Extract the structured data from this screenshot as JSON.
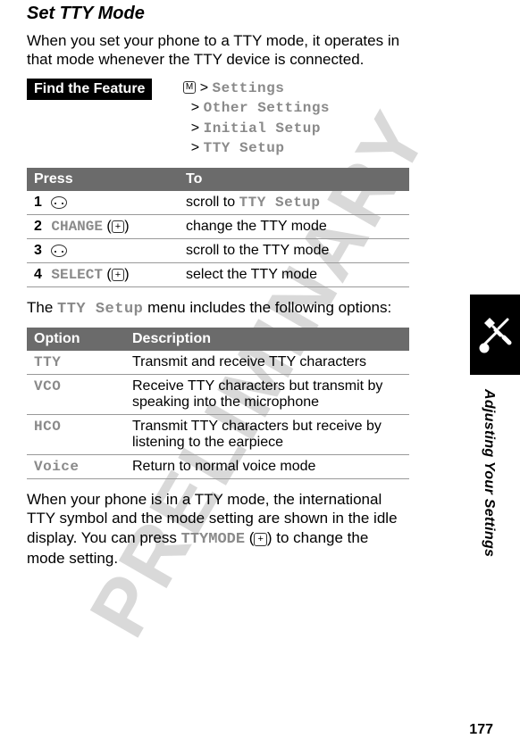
{
  "watermark": "PRELIMINARY",
  "heading": "Set TTY Mode",
  "intro": "When you set your phone to a TTY mode, it operates in that mode whenever the TTY device is connected.",
  "feature_label": "Find the Feature",
  "menu_key": "M",
  "path": {
    "gt": ">",
    "lvl1": "Settings",
    "lvl2": "Other Settings",
    "lvl3": "Initial Setup",
    "lvl4": "TTY Setup"
  },
  "steps_header": {
    "press": "Press",
    "to": "To"
  },
  "steps": [
    {
      "n": "1",
      "press_type": "nav",
      "to_pre": "scroll to ",
      "to_mono": "TTY Setup",
      "to_post": ""
    },
    {
      "n": "2",
      "press_type": "soft",
      "soft": "CHANGE",
      "key": "+",
      "to_pre": "change the TTY mode",
      "to_mono": "",
      "to_post": ""
    },
    {
      "n": "3",
      "press_type": "nav",
      "to_pre": "scroll to the TTY mode",
      "to_mono": "",
      "to_post": ""
    },
    {
      "n": "4",
      "press_type": "soft",
      "soft": "SELECT",
      "key": "+",
      "to_pre": "select the TTY mode",
      "to_mono": "",
      "to_post": ""
    }
  ],
  "mid_pre": "The ",
  "mid_mono": "TTY Setup",
  "mid_post": " menu includes the following options:",
  "options_header": {
    "option": "Option",
    "description": "Description"
  },
  "options": [
    {
      "name": "TTY",
      "desc": "Transmit and receive TTY characters"
    },
    {
      "name": "VCO",
      "desc": "Receive TTY characters but transmit by speaking into the microphone"
    },
    {
      "name": "HCO",
      "desc": "Transmit TTY characters but receive by listening to the earpiece"
    },
    {
      "name": "Voice",
      "desc": "Return to normal voice mode"
    }
  ],
  "out_pre": "When your phone is in a TTY mode, the international TTY symbol and the mode setting are shown in the idle display. You can press ",
  "out_mono": "TTYMODE",
  "out_key": "+",
  "out_post": ") to change the mode setting.",
  "out_paren": " (",
  "side_label": "Adjusting Your Settings",
  "page_num": "177"
}
